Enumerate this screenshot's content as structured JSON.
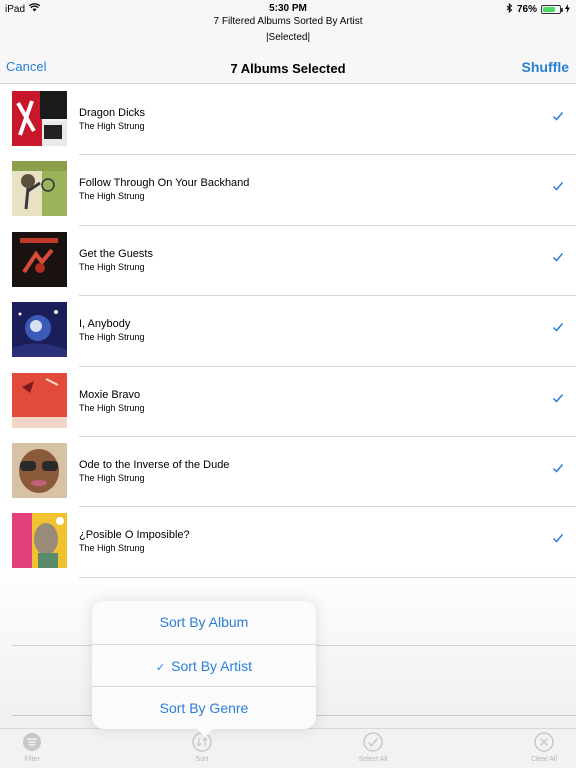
{
  "status_bar": {
    "device": "iPad",
    "time": "5:30 PM",
    "battery_percent": "76%",
    "battery_level": 0.76,
    "icons": [
      "wifi-icon",
      "bluetooth-icon",
      "battery-icon",
      "charging-icon"
    ]
  },
  "header": {
    "subtitle": "7 Filtered Albums Sorted By Artist",
    "subtitle_2": "|Selected|",
    "cancel_label": "Cancel",
    "title": "7 Albums Selected",
    "shuffle_label": "Shuffle"
  },
  "albums": [
    {
      "title": "Dragon Dicks",
      "artist": "The High Strung",
      "selected": true
    },
    {
      "title": "Follow Through On Your Backhand",
      "artist": "The High Strung",
      "selected": true
    },
    {
      "title": "Get the Guests",
      "artist": "The High Strung",
      "selected": true
    },
    {
      "title": "I, Anybody",
      "artist": "The High Strung",
      "selected": true
    },
    {
      "title": "Moxie Bravo",
      "artist": "The High Strung",
      "selected": true
    },
    {
      "title": "Ode to the Inverse of the Dude",
      "artist": "The High Strung",
      "selected": true
    },
    {
      "title": "¿Posible O Imposible?",
      "artist": "The High Strung",
      "selected": true
    }
  ],
  "popover": {
    "items": [
      {
        "label": "Sort By Album",
        "checked": false
      },
      {
        "label": "Sort By Artist",
        "checked": true,
        "check_glyph": "✓"
      },
      {
        "label": "Sort By Genre",
        "checked": false
      }
    ]
  },
  "tab_bar": {
    "items": [
      {
        "label": "Filter",
        "icon": "filter-icon"
      },
      {
        "label": "Sort",
        "icon": "sort-icon"
      },
      {
        "label": "Select All",
        "icon": "checkmark-circle-icon"
      },
      {
        "label": "Clear All",
        "icon": "x-circle-icon"
      }
    ]
  },
  "colors": {
    "accent": "#2a7fd4",
    "bar_background": "#f7f7f7",
    "separator": "#d6d6d6",
    "tab_inactive": "#b5b5b5",
    "battery_green": "#4cd964"
  }
}
